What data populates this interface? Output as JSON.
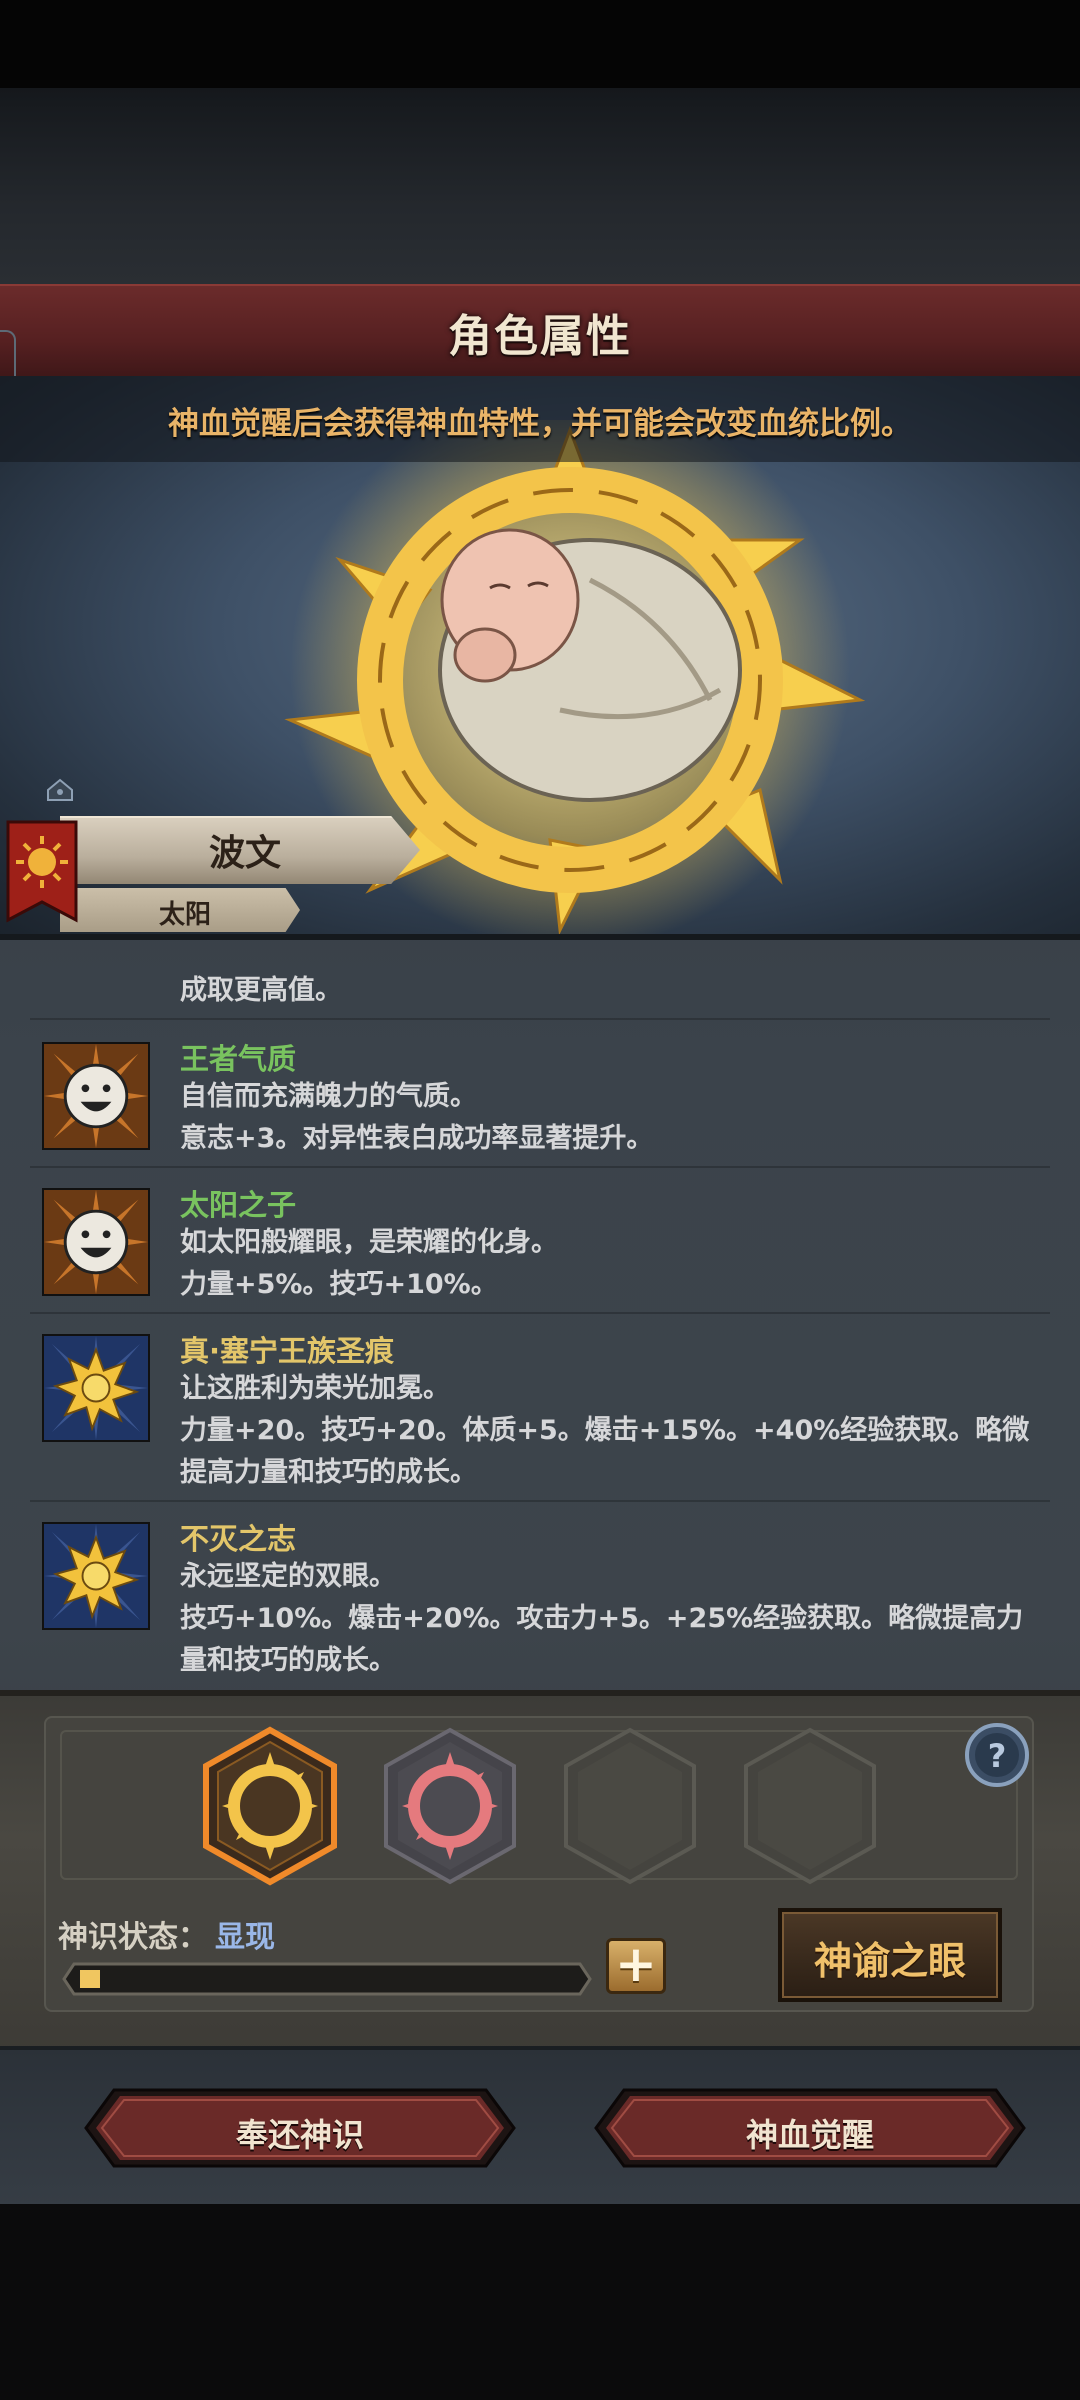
{
  "header": {
    "title": "角色属性",
    "subtitle": "神血觉醒后会获得神血特性，并可能会改变血统比例。"
  },
  "character": {
    "name": "波文",
    "house": "太阳"
  },
  "traits": {
    "partial_top_line": "成取更高值。",
    "items": [
      {
        "name": "王者气质",
        "color": "#79c35f",
        "icon": "smiley-sunburst-icon",
        "lines": [
          "自信而充满魄力的气质。",
          "意志+3。对异性表白成功率显著提升。"
        ]
      },
      {
        "name": "太阳之子",
        "color": "#79c35f",
        "icon": "smiley-sunburst-icon",
        "lines": [
          "如太阳般耀眼，是荣耀的化身。",
          "力量+5%。技巧+10%。"
        ]
      },
      {
        "name": "真·塞宁王族圣痕",
        "color": "#e3c66a",
        "icon": "golden-sun-sigil-icon",
        "lines": [
          "让这胜利为荣光加冕。",
          "力量+20。技巧+20。体质+5。爆击+15%。+40%经验获取。略微",
          "提高力量和技巧的成长。"
        ]
      },
      {
        "name": "不灭之志",
        "color": "#e3c66a",
        "icon": "golden-sun-sigil-icon",
        "lines": [
          "永远坚定的双眼。",
          "技巧+10%。爆击+20%。攻击力+5。+25%经验获取。略微提高力",
          "量和技巧的成长。"
        ]
      }
    ]
  },
  "divine": {
    "status_label": "神识状态：",
    "status_value": "显现",
    "progress": 0.04,
    "oracle_button": "神谕之眼"
  },
  "actions": {
    "return_button": "奉还神识",
    "awaken_button": "神血觉醒"
  },
  "colors": {
    "accent_gold": "#e9b468",
    "trait_green": "#79c35f",
    "trait_gold": "#e3c66a",
    "status_blue": "#9ab7e8",
    "title_red": "#562021"
  }
}
